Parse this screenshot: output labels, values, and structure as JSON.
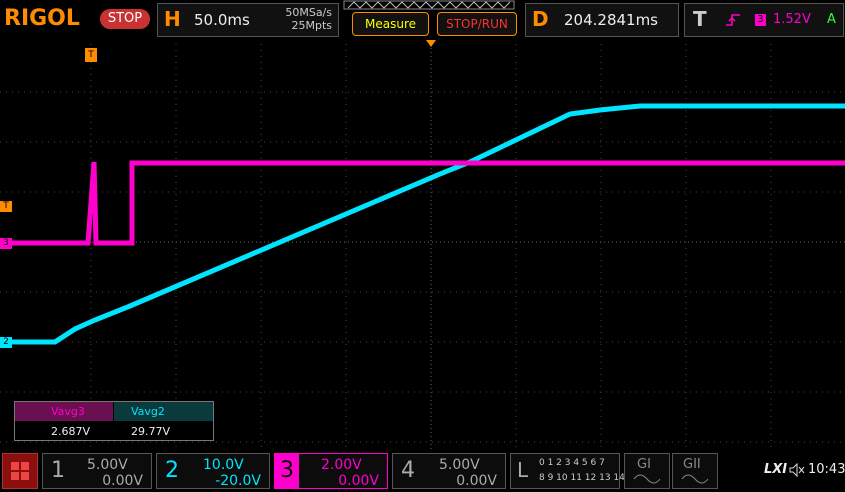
{
  "brand": "RIGOL",
  "run_state": "STOP",
  "horizontal": {
    "label": "H",
    "timebase": "50.0ms",
    "sample_rate": "50MSa/s",
    "memory": "25Mpts"
  },
  "buttons": {
    "measure": "Measure",
    "stop_run": "STOP/RUN"
  },
  "delay": {
    "label": "D",
    "value": "204.2841ms"
  },
  "trigger": {
    "label": "T",
    "source": "3",
    "level": "1.52V",
    "mode": "A"
  },
  "markers": {
    "trigger_top": "T",
    "trigger_left": "T",
    "ch3": "3",
    "ch2": "2"
  },
  "measurements": [
    {
      "name": "Vavg3",
      "value": "2.687V",
      "color": "#ff00cc"
    },
    {
      "name": "Vavg2",
      "value": "29.77V",
      "color": "#00e5ff"
    }
  ],
  "channels": [
    {
      "num": "1",
      "scale": "5.00V",
      "offset": "0.00V",
      "color": "#ffff00"
    },
    {
      "num": "2",
      "scale": "10.0V",
      "offset": "-20.0V",
      "color": "#00e5ff"
    },
    {
      "num": "3",
      "scale": "2.00V",
      "offset": "0.00V",
      "color": "#ff00cc"
    },
    {
      "num": "4",
      "scale": "5.00V",
      "offset": "0.00V",
      "color": "#3f8fff"
    }
  ],
  "logic": {
    "label": "L",
    "row1": "0 1 2 3 4 5 6 7",
    "row2": "8 9 10 11 12 13 14 15"
  },
  "generators": {
    "g1": "GI",
    "g2": "GII"
  },
  "status": {
    "lxi": "LXI",
    "time": "10:43"
  },
  "colors": {
    "accent": "#ff8c00",
    "ch2": "#00e5ff",
    "ch3": "#ff00cc",
    "stop": "#c83232"
  }
}
